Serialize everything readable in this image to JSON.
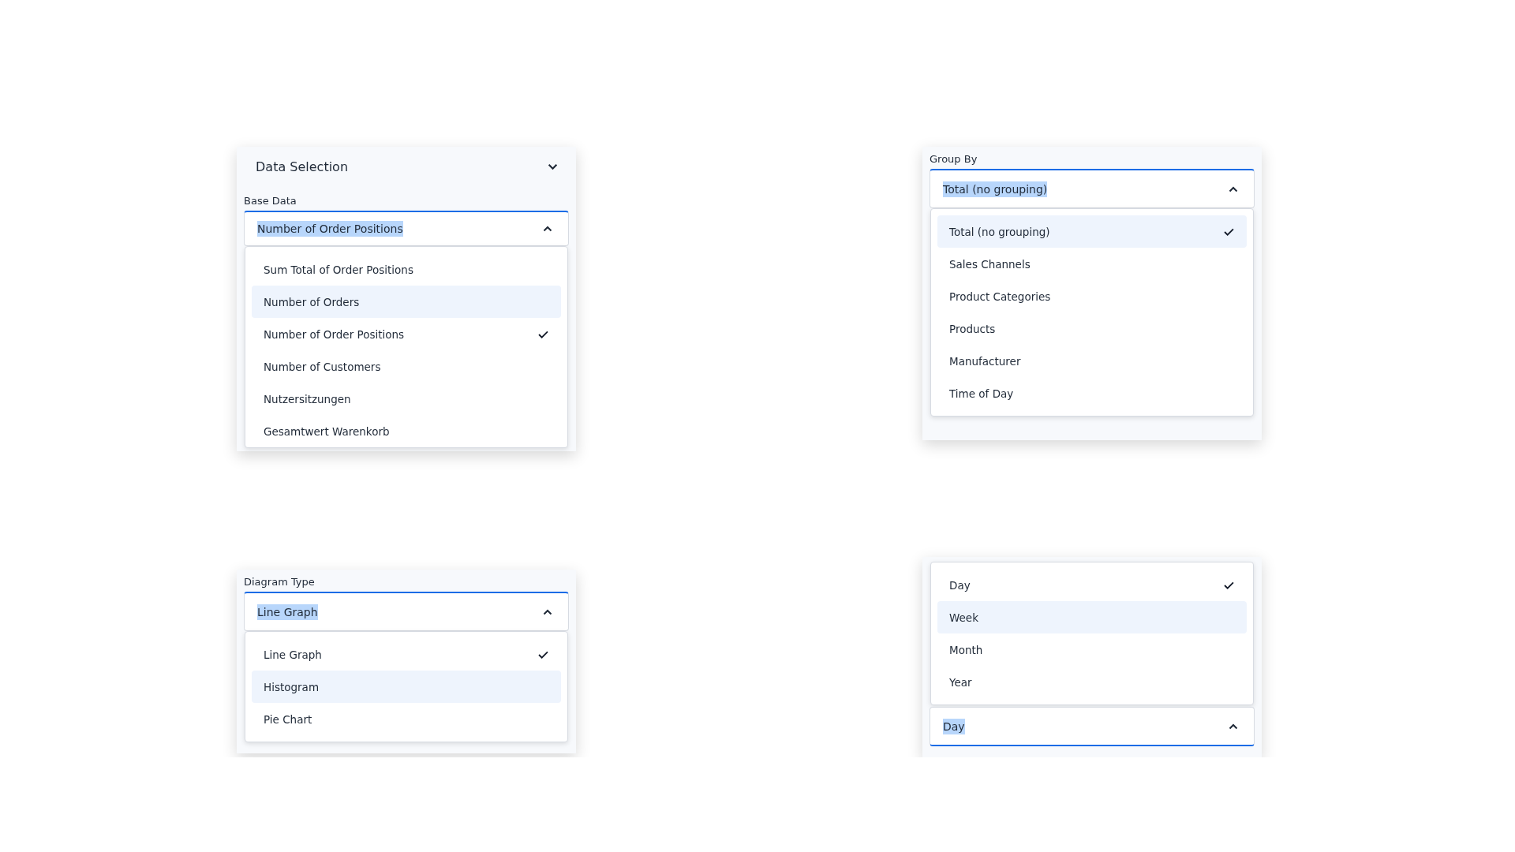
{
  "panels": [
    {
      "header": "Data Selection",
      "label": "Base Data",
      "field": {
        "value": "Number of Order Positions",
        "open": true
      },
      "opens_upward": false,
      "options": [
        {
          "label": "Sum Total of Order Positions",
          "selected": false,
          "highlighted": false
        },
        {
          "label": "Number of Orders",
          "selected": false,
          "highlighted": true
        },
        {
          "label": "Number of Order Positions",
          "selected": true,
          "highlighted": false
        },
        {
          "label": "Number of Customers",
          "selected": false,
          "highlighted": false
        },
        {
          "label": "Nutzersitzungen",
          "selected": false,
          "highlighted": false
        },
        {
          "label": "Gesamtwert Warenkorb",
          "selected": false,
          "highlighted": false
        }
      ]
    },
    {
      "label": "Group By",
      "field": {
        "value": "Total (no grouping)",
        "open": true
      },
      "opens_upward": false,
      "options": [
        {
          "label": "Total (no grouping)",
          "selected": true,
          "highlighted": true
        },
        {
          "label": "Sales Channels",
          "selected": false,
          "highlighted": false
        },
        {
          "label": "Product Categories",
          "selected": false,
          "highlighted": false
        },
        {
          "label": "Products",
          "selected": false,
          "highlighted": false
        },
        {
          "label": "Manufacturer",
          "selected": false,
          "highlighted": false
        },
        {
          "label": "Time of Day",
          "selected": false,
          "highlighted": false
        }
      ]
    },
    {
      "label": "Diagram Type",
      "field": {
        "value": "Line Graph",
        "open": true
      },
      "opens_upward": false,
      "options": [
        {
          "label": "Line Graph",
          "selected": true,
          "highlighted": false
        },
        {
          "label": "Histogram",
          "selected": false,
          "highlighted": true
        },
        {
          "label": "Pie Chart",
          "selected": false,
          "highlighted": false
        }
      ]
    },
    {
      "field": {
        "value": "Day",
        "open": true
      },
      "opens_upward": true,
      "options": [
        {
          "label": "Day",
          "selected": true,
          "highlighted": false
        },
        {
          "label": "Week",
          "selected": false,
          "highlighted": true
        },
        {
          "label": "Month",
          "selected": false,
          "highlighted": false
        },
        {
          "label": "Year",
          "selected": false,
          "highlighted": false
        }
      ]
    }
  ]
}
